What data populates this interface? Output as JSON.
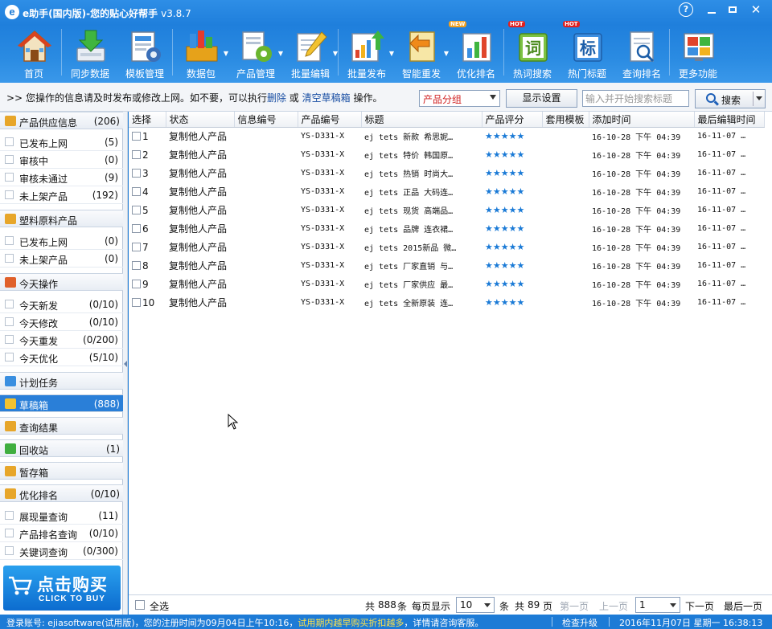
{
  "window": {
    "title": "e助手(国内版)-您的贴心好帮手",
    "version": "v3.8.7",
    "controls": [
      "help-icon",
      "minimize-icon",
      "maximize-icon",
      "close-icon"
    ]
  },
  "toolbar": {
    "items": [
      {
        "label": "首页",
        "icon": "home-icon"
      },
      {
        "label": "同步数据",
        "icon": "sync-download-icon"
      },
      {
        "label": "模板管理",
        "icon": "template-gear-icon"
      },
      {
        "label": "数据包",
        "icon": "data-package-icon"
      },
      {
        "label": "产品管理",
        "icon": "product-gear-icon"
      },
      {
        "label": "批量编辑",
        "icon": "batch-edit-icon"
      },
      {
        "label": "批量发布",
        "icon": "batch-publish-icon"
      },
      {
        "label": "智能重发",
        "icon": "smart-repost-icon"
      },
      {
        "label": "优化排名",
        "icon": "rank-chart-icon",
        "badge": "NEW"
      },
      {
        "label": "热词搜索",
        "icon": "hot-word-icon",
        "badge": "HOT",
        "glyph": "词"
      },
      {
        "label": "热门标题",
        "icon": "hot-title-icon",
        "badge": "HOT",
        "glyph": "标"
      },
      {
        "label": "查询排名",
        "icon": "query-rank-icon"
      },
      {
        "label": "更多功能",
        "icon": "windows-more-icon"
      }
    ]
  },
  "infobar": {
    "prefix": ">>",
    "text_before": "您操作的信息请及时发布或修改上网。如不要，可以执行",
    "link_delete": "删除",
    "text_or": "或",
    "link_clear": "清空草稿箱",
    "text_after": "操作。",
    "group_select": "产品分组",
    "display_button": "显示设置",
    "search_placeholder": "输入并开始搜索标题",
    "search_button": "搜索"
  },
  "sidebar": {
    "sections": [
      {
        "name": "产品供应信息",
        "count": "(206)",
        "icon": "folder-icon",
        "items": [
          {
            "name": "已发布上网",
            "count": "(5)"
          },
          {
            "name": "审核中",
            "count": "(0)"
          },
          {
            "name": "审核未通过",
            "count": "(9)"
          },
          {
            "name": "未上架产品",
            "count": "(192)"
          }
        ]
      },
      {
        "name": "塑料原料产品",
        "count": "",
        "icon": "folder-icon",
        "items": [
          {
            "name": "已发布上网",
            "count": "(0)"
          },
          {
            "name": "未上架产品",
            "count": "(0)"
          }
        ]
      },
      {
        "name": "今天操作",
        "count": "",
        "icon": "today-icon",
        "items": [
          {
            "name": "今天新发",
            "count": "(0/10)"
          },
          {
            "name": "今天修改",
            "count": "(0/10)"
          },
          {
            "name": "今天重发",
            "count": "(0/200)"
          },
          {
            "name": "今天优化",
            "count": "(5/10)"
          }
        ]
      },
      {
        "name": "计划任务",
        "count": "",
        "icon": "task-icon",
        "items": []
      },
      {
        "name": "草稿箱",
        "count": "(888)",
        "icon": "draft-icon",
        "active": true,
        "items": []
      },
      {
        "name": "查询结果",
        "count": "",
        "icon": "query-result-icon",
        "items": []
      },
      {
        "name": "回收站",
        "count": "(1)",
        "icon": "recycle-icon",
        "items": []
      },
      {
        "name": "暂存箱",
        "count": "",
        "icon": "temp-box-icon",
        "items": []
      },
      {
        "name": "优化排名",
        "count": "(0/10)",
        "icon": "optimize-icon",
        "items": [
          {
            "name": "展现量查询",
            "count": "(11)"
          },
          {
            "name": "产品排名查询",
            "count": "(0/10)"
          },
          {
            "name": "关键词查询",
            "count": "(0/300)"
          }
        ]
      }
    ],
    "buy_banner": {
      "big": "点击购买",
      "small": "CLICK TO BUY"
    }
  },
  "table": {
    "columns": [
      "选择",
      "状态",
      "信息编号",
      "产品编号",
      "标题",
      "产品评分",
      "套用模板",
      "添加时间",
      "最后编辑时间"
    ],
    "rows": [
      {
        "no": "1",
        "status": "复制他人产品",
        "info_id": "",
        "product_id": "YS-D331-X",
        "title": "ej tets 新款 希思妮…",
        "rating": "★★★★★",
        "template": "",
        "added": "16-10-28  下午 04:39",
        "edited": "16-11-07 …"
      },
      {
        "no": "2",
        "status": "复制他人产品",
        "info_id": "",
        "product_id": "YS-D331-X",
        "title": "ej tets 特价 韩国原…",
        "rating": "★★★★★",
        "template": "",
        "added": "16-10-28  下午 04:39",
        "edited": "16-11-07 …"
      },
      {
        "no": "3",
        "status": "复制他人产品",
        "info_id": "",
        "product_id": "YS-D331-X",
        "title": "ej tets 热销 时尚大…",
        "rating": "★★★★★",
        "template": "",
        "added": "16-10-28  下午 04:39",
        "edited": "16-11-07 …"
      },
      {
        "no": "4",
        "status": "复制他人产品",
        "info_id": "",
        "product_id": "YS-D331-X",
        "title": "ej tets 正品 大码连…",
        "rating": "★★★★★",
        "template": "",
        "added": "16-10-28  下午 04:39",
        "edited": "16-11-07 …"
      },
      {
        "no": "5",
        "status": "复制他人产品",
        "info_id": "",
        "product_id": "YS-D331-X",
        "title": "ej tets 现货 高端品…",
        "rating": "★★★★★",
        "template": "",
        "added": "16-10-28  下午 04:39",
        "edited": "16-11-07 …"
      },
      {
        "no": "6",
        "status": "复制他人产品",
        "info_id": "",
        "product_id": "YS-D331-X",
        "title": "ej tets 品牌 连衣裙…",
        "rating": "★★★★★",
        "template": "",
        "added": "16-10-28  下午 04:39",
        "edited": "16-11-07 …"
      },
      {
        "no": "7",
        "status": "复制他人产品",
        "info_id": "",
        "product_id": "YS-D331-X",
        "title": "ej tets 2015新品 微…",
        "rating": "★★★★★",
        "template": "",
        "added": "16-10-28  下午 04:39",
        "edited": "16-11-07 …"
      },
      {
        "no": "8",
        "status": "复制他人产品",
        "info_id": "",
        "product_id": "YS-D331-X",
        "title": "ej tets 厂家直销 与…",
        "rating": "★★★★★",
        "template": "",
        "added": "16-10-28  下午 04:39",
        "edited": "16-11-07 …"
      },
      {
        "no": "9",
        "status": "复制他人产品",
        "info_id": "",
        "product_id": "YS-D331-X",
        "title": "ej tets 厂家供应 最…",
        "rating": "★★★★★",
        "template": "",
        "added": "16-10-28  下午 04:39",
        "edited": "16-11-07 …"
      },
      {
        "no": "10",
        "status": "复制他人产品",
        "info_id": "",
        "product_id": "YS-D331-X",
        "title": "ej tets 全新原装 连…",
        "rating": "★★★★★",
        "template": "",
        "added": "16-10-28  下午 04:39",
        "edited": "16-11-07 …"
      }
    ]
  },
  "pager": {
    "select_all": "全选",
    "total_prefix": "共",
    "total": "888",
    "total_suffix": "条",
    "per_page_label": "每页显示",
    "per_page": "10",
    "per_page_suffix": "条",
    "pages_prefix": "共",
    "pages": "89",
    "pages_suffix": "页",
    "first": "第一页",
    "prev": "上一页",
    "current_page": "1",
    "next": "下一页",
    "last": "最后一页"
  },
  "statusbar": {
    "account_label": "登录账号:",
    "account": "ejiasoftware",
    "trial": "(试用版)",
    "register_info": "，您的注册时间为09月04日上午10:16，",
    "promo": "试用期内越早购买折扣越多",
    "contact": "，详情请咨询客服。",
    "check_update": "检查升级",
    "datetime": "2016年11月07日 星期一 16:38:13"
  },
  "colors": {
    "chrome_blue": "#1d7bd6",
    "active_section": "#2a7fd8",
    "star_blue": "#1a7ad6",
    "link_blue": "#1a4fa3",
    "select_red": "#d02020",
    "promo_yellow": "#ffe24a"
  }
}
